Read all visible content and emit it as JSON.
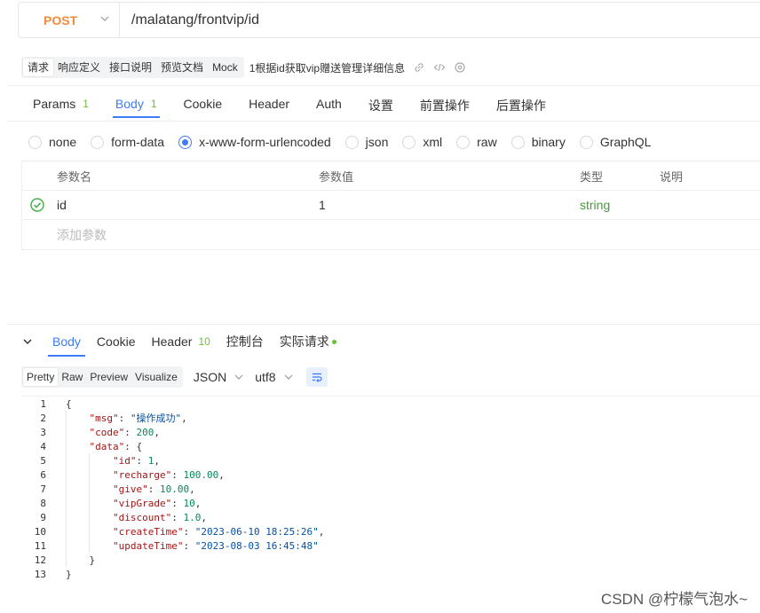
{
  "request": {
    "method": "POST",
    "url": "/malatang/frontvip/id"
  },
  "toolbar": {
    "items": [
      "请求",
      "响应定义",
      "接口说明",
      "预览文档",
      "Mock"
    ],
    "description": "1根据id获取vip赠送管理详细信息"
  },
  "request_tabs": [
    {
      "label": "Params",
      "badge": "1"
    },
    {
      "label": "Body",
      "badge": "1"
    },
    {
      "label": "Cookie",
      "badge": ""
    },
    {
      "label": "Header",
      "badge": ""
    },
    {
      "label": "Auth",
      "badge": ""
    },
    {
      "label": "设置",
      "badge": ""
    },
    {
      "label": "前置操作",
      "badge": ""
    },
    {
      "label": "后置操作",
      "badge": ""
    }
  ],
  "body_types": [
    "none",
    "form-data",
    "x-www-form-urlencoded",
    "json",
    "xml",
    "raw",
    "binary",
    "GraphQL"
  ],
  "body_type_selected": "x-www-form-urlencoded",
  "param_table": {
    "headers": {
      "name": "参数名",
      "value": "参数值",
      "type": "类型",
      "desc": "说明"
    },
    "rows": [
      {
        "name": "id",
        "value": "1",
        "type": "string",
        "desc": ""
      }
    ],
    "add_placeholder": "添加参数"
  },
  "response_tabs": [
    {
      "label": "Body",
      "badge": ""
    },
    {
      "label": "Cookie",
      "badge": ""
    },
    {
      "label": "Header",
      "badge": "10"
    },
    {
      "label": "控制台",
      "badge": ""
    },
    {
      "label": "实际请求",
      "badge": ""
    }
  ],
  "format_modes": [
    "Pretty",
    "Raw",
    "Preview",
    "Visualize"
  ],
  "format_selected": "Pretty",
  "format_type": "JSON",
  "encoding": "utf8",
  "response_lines": [
    "{",
    "    \"msg\": \"操作成功\",",
    "    \"code\": 200,",
    "    \"data\": {",
    "        \"id\": 1,",
    "        \"recharge\": 100.00,",
    "        \"give\": 10.00,",
    "        \"vipGrade\": 10,",
    "        \"discount\": 1.0,",
    "        \"createTime\": \"2023-06-10 18:25:26\",",
    "        \"updateTime\": \"2023-08-03 16:45:48\"",
    "    }",
    "}"
  ],
  "watermark": "CSDN @柠檬气泡水~",
  "colors": {
    "accent": "#3d7cf6",
    "method": "#f28a3c",
    "badge": "#67c23a",
    "type_string": "#4a9a3e"
  }
}
